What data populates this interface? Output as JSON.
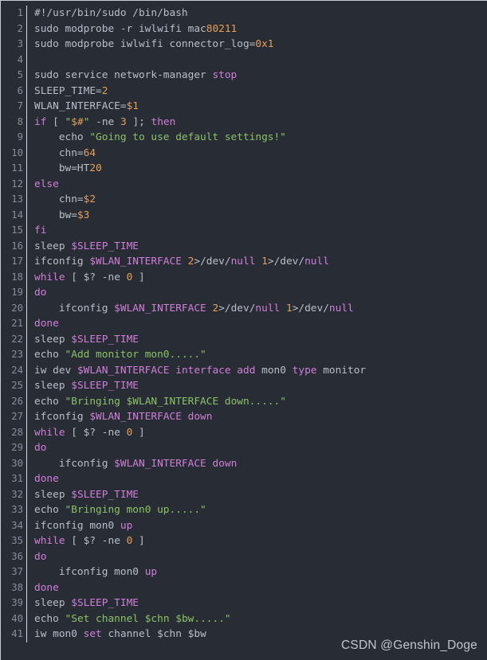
{
  "editor": {
    "language": "bash",
    "total_lines": 41,
    "background_color": "#282c34",
    "gutter_color": "#868e9c",
    "default_text_color": "#b8bfca",
    "keyword_color": "#d07fd8",
    "string_color": "#8cc265",
    "number_color": "#e5a05a",
    "variable_color": "#d07fd8"
  },
  "watermark": {
    "text": "CSDN @Genshin_Doge"
  },
  "lines": [
    {
      "n": "1",
      "tokens": [
        {
          "t": "#!/usr/bin/sudo /bin/bash",
          "c": "def"
        }
      ]
    },
    {
      "n": "2",
      "tokens": [
        {
          "t": "sudo modprobe -r iwlwifi mac",
          "c": "def"
        },
        {
          "t": "80211",
          "c": "num"
        }
      ]
    },
    {
      "n": "3",
      "tokens": [
        {
          "t": "sudo modprobe iwlwifi connector_log=",
          "c": "def"
        },
        {
          "t": "0x1",
          "c": "num"
        }
      ]
    },
    {
      "n": "4",
      "tokens": [
        {
          "t": "",
          "c": "def"
        }
      ]
    },
    {
      "n": "5",
      "tokens": [
        {
          "t": "sudo service network-manager ",
          "c": "def"
        },
        {
          "t": "stop",
          "c": "kw"
        }
      ]
    },
    {
      "n": "6",
      "tokens": [
        {
          "t": "SLEEP_TIME=",
          "c": "def"
        },
        {
          "t": "2",
          "c": "num"
        }
      ]
    },
    {
      "n": "7",
      "tokens": [
        {
          "t": "WLAN_INTERFACE=",
          "c": "def"
        },
        {
          "t": "$1",
          "c": "num"
        }
      ]
    },
    {
      "n": "8",
      "tokens": [
        {
          "t": "if",
          "c": "kw"
        },
        {
          "t": " [ ",
          "c": "def"
        },
        {
          "t": "\"",
          "c": "str"
        },
        {
          "t": "$#",
          "c": "ins"
        },
        {
          "t": "\"",
          "c": "str"
        },
        {
          "t": " -ne ",
          "c": "def"
        },
        {
          "t": "3",
          "c": "num"
        },
        {
          "t": " ]; ",
          "c": "def"
        },
        {
          "t": "then",
          "c": "kw"
        }
      ]
    },
    {
      "n": "9",
      "tokens": [
        {
          "t": "    echo ",
          "c": "def"
        },
        {
          "t": "\"Going to use default settings!\"",
          "c": "str"
        }
      ]
    },
    {
      "n": "10",
      "tokens": [
        {
          "t": "    chn=",
          "c": "def"
        },
        {
          "t": "64",
          "c": "num"
        }
      ]
    },
    {
      "n": "11",
      "tokens": [
        {
          "t": "    bw=HT",
          "c": "def"
        },
        {
          "t": "20",
          "c": "num"
        }
      ]
    },
    {
      "n": "12",
      "tokens": [
        {
          "t": "else",
          "c": "kw"
        }
      ]
    },
    {
      "n": "13",
      "tokens": [
        {
          "t": "    chn=",
          "c": "def"
        },
        {
          "t": "$2",
          "c": "num"
        }
      ]
    },
    {
      "n": "14",
      "tokens": [
        {
          "t": "    bw=",
          "c": "def"
        },
        {
          "t": "$3",
          "c": "num"
        }
      ]
    },
    {
      "n": "15",
      "tokens": [
        {
          "t": "fi",
          "c": "kw"
        }
      ]
    },
    {
      "n": "16",
      "tokens": [
        {
          "t": "sleep ",
          "c": "def"
        },
        {
          "t": "$SLEEP_TIME",
          "c": "var"
        }
      ]
    },
    {
      "n": "17",
      "tokens": [
        {
          "t": "ifconfig ",
          "c": "def"
        },
        {
          "t": "$WLAN_INTERFACE",
          "c": "var"
        },
        {
          "t": " ",
          "c": "def"
        },
        {
          "t": "2",
          "c": "num"
        },
        {
          "t": ">/dev/",
          "c": "def"
        },
        {
          "t": "null",
          "c": "kw"
        },
        {
          "t": " ",
          "c": "def"
        },
        {
          "t": "1",
          "c": "num"
        },
        {
          "t": ">/dev/",
          "c": "def"
        },
        {
          "t": "null",
          "c": "kw"
        }
      ]
    },
    {
      "n": "18",
      "tokens": [
        {
          "t": "while",
          "c": "kw"
        },
        {
          "t": " [ ",
          "c": "def"
        },
        {
          "t": "$?",
          "c": "def"
        },
        {
          "t": " -ne ",
          "c": "def"
        },
        {
          "t": "0",
          "c": "num"
        },
        {
          "t": " ]",
          "c": "def"
        }
      ]
    },
    {
      "n": "19",
      "tokens": [
        {
          "t": "do",
          "c": "kw"
        }
      ]
    },
    {
      "n": "20",
      "tokens": [
        {
          "t": "    ifconfig ",
          "c": "def"
        },
        {
          "t": "$WLAN_INTERFACE",
          "c": "var"
        },
        {
          "t": " ",
          "c": "def"
        },
        {
          "t": "2",
          "c": "num"
        },
        {
          "t": ">/dev/",
          "c": "def"
        },
        {
          "t": "null",
          "c": "kw"
        },
        {
          "t": " ",
          "c": "def"
        },
        {
          "t": "1",
          "c": "num"
        },
        {
          "t": ">/dev/",
          "c": "def"
        },
        {
          "t": "null",
          "c": "kw"
        }
      ]
    },
    {
      "n": "21",
      "tokens": [
        {
          "t": "done",
          "c": "kw"
        }
      ]
    },
    {
      "n": "22",
      "tokens": [
        {
          "t": "sleep ",
          "c": "def"
        },
        {
          "t": "$SLEEP_TIME",
          "c": "var"
        }
      ]
    },
    {
      "n": "23",
      "tokens": [
        {
          "t": "echo ",
          "c": "def"
        },
        {
          "t": "\"Add monitor mon0.....\"",
          "c": "str"
        }
      ]
    },
    {
      "n": "24",
      "tokens": [
        {
          "t": "iw dev ",
          "c": "def"
        },
        {
          "t": "$WLAN_INTERFACE",
          "c": "var"
        },
        {
          "t": " ",
          "c": "def"
        },
        {
          "t": "interface",
          "c": "kw"
        },
        {
          "t": " ",
          "c": "def"
        },
        {
          "t": "add",
          "c": "kw"
        },
        {
          "t": " mon0 ",
          "c": "def"
        },
        {
          "t": "type",
          "c": "kw"
        },
        {
          "t": " monitor",
          "c": "def"
        }
      ]
    },
    {
      "n": "25",
      "tokens": [
        {
          "t": "sleep ",
          "c": "def"
        },
        {
          "t": "$SLEEP_TIME",
          "c": "var"
        }
      ]
    },
    {
      "n": "26",
      "tokens": [
        {
          "t": "echo ",
          "c": "def"
        },
        {
          "t": "\"Bringing ",
          "c": "str"
        },
        {
          "t": "$WLAN_INTERFACE",
          "c": "varg"
        },
        {
          "t": " down.....\"",
          "c": "str"
        }
      ]
    },
    {
      "n": "27",
      "tokens": [
        {
          "t": "ifconfig ",
          "c": "def"
        },
        {
          "t": "$WLAN_INTERFACE",
          "c": "var"
        },
        {
          "t": " ",
          "c": "def"
        },
        {
          "t": "down",
          "c": "kw"
        }
      ]
    },
    {
      "n": "28",
      "tokens": [
        {
          "t": "while",
          "c": "kw"
        },
        {
          "t": " [ ",
          "c": "def"
        },
        {
          "t": "$?",
          "c": "def"
        },
        {
          "t": " -ne ",
          "c": "def"
        },
        {
          "t": "0",
          "c": "num"
        },
        {
          "t": " ]",
          "c": "def"
        }
      ]
    },
    {
      "n": "29",
      "tokens": [
        {
          "t": "do",
          "c": "kw"
        }
      ]
    },
    {
      "n": "30",
      "tokens": [
        {
          "t": "    ifconfig ",
          "c": "def"
        },
        {
          "t": "$WLAN_INTERFACE",
          "c": "var"
        },
        {
          "t": " ",
          "c": "def"
        },
        {
          "t": "down",
          "c": "kw"
        }
      ]
    },
    {
      "n": "31",
      "tokens": [
        {
          "t": "done",
          "c": "kw"
        }
      ]
    },
    {
      "n": "32",
      "tokens": [
        {
          "t": "sleep ",
          "c": "def"
        },
        {
          "t": "$SLEEP_TIME",
          "c": "var"
        }
      ]
    },
    {
      "n": "33",
      "tokens": [
        {
          "t": "echo ",
          "c": "def"
        },
        {
          "t": "\"Bringing mon0 up.....\"",
          "c": "str"
        }
      ]
    },
    {
      "n": "34",
      "tokens": [
        {
          "t": "ifconfig mon0 ",
          "c": "def"
        },
        {
          "t": "up",
          "c": "kw"
        }
      ]
    },
    {
      "n": "35",
      "tokens": [
        {
          "t": "while",
          "c": "kw"
        },
        {
          "t": " [ ",
          "c": "def"
        },
        {
          "t": "$?",
          "c": "def"
        },
        {
          "t": " -ne ",
          "c": "def"
        },
        {
          "t": "0",
          "c": "num"
        },
        {
          "t": " ]",
          "c": "def"
        }
      ]
    },
    {
      "n": "36",
      "tokens": [
        {
          "t": "do",
          "c": "kw"
        }
      ]
    },
    {
      "n": "37",
      "tokens": [
        {
          "t": "    ifconfig mon0 ",
          "c": "def"
        },
        {
          "t": "up",
          "c": "kw"
        }
      ]
    },
    {
      "n": "38",
      "tokens": [
        {
          "t": "done",
          "c": "kw"
        }
      ]
    },
    {
      "n": "39",
      "tokens": [
        {
          "t": "sleep ",
          "c": "def"
        },
        {
          "t": "$SLEEP_TIME",
          "c": "var"
        }
      ]
    },
    {
      "n": "40",
      "tokens": [
        {
          "t": "echo ",
          "c": "def"
        },
        {
          "t": "\"Set channel ",
          "c": "str"
        },
        {
          "t": "$chn",
          "c": "varg"
        },
        {
          "t": " ",
          "c": "str"
        },
        {
          "t": "$bw",
          "c": "varg"
        },
        {
          "t": ".....\"",
          "c": "str"
        }
      ]
    },
    {
      "n": "41",
      "tokens": [
        {
          "t": "iw mon0 ",
          "c": "def"
        },
        {
          "t": "set",
          "c": "kw"
        },
        {
          "t": " channel ",
          "c": "def"
        },
        {
          "t": "$chn",
          "c": "def"
        },
        {
          "t": " ",
          "c": "def"
        },
        {
          "t": "$bw",
          "c": "def"
        }
      ]
    }
  ]
}
